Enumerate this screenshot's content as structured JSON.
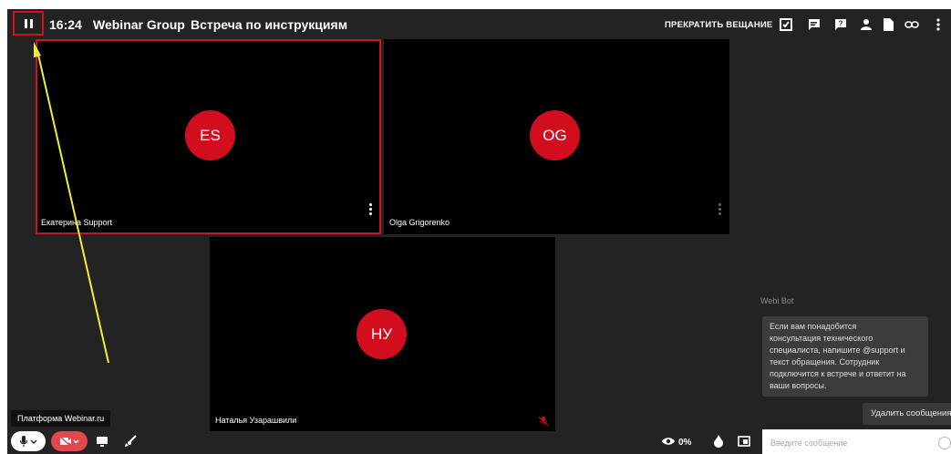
{
  "header": {
    "time": "16:24",
    "group": "Webinar Group",
    "title": "Встреча по инструкциям",
    "stop_broadcast": "ПРЕКРАТИТЬ ВЕЩАНИЕ",
    "icons": [
      "tasks-icon",
      "chat-icon",
      "question-icon",
      "person-icon",
      "document-icon",
      "link-icon",
      "more-icon"
    ]
  },
  "participants": [
    {
      "initials": "ES",
      "name": "Екатерина Support",
      "active": true
    },
    {
      "initials": "OG",
      "name": "Olga Grigorenko",
      "active": false
    },
    {
      "initials": "НУ",
      "name": "Наталья Узарашвили",
      "active": false,
      "muted": true
    }
  ],
  "chat": {
    "sender": "Webi Bot",
    "message": "Если вам понадобится\nконсультация технического\nспециалиста, напишите @support и\nтекст обращения. Сотрудник\nподключится к встрече и ответит на\nваши вопросы.",
    "delete_button": "Удалить сообщения",
    "input_placeholder": "Введите сообщение"
  },
  "tooltip": "Платформа Webinar.ru",
  "bottom": {
    "view_percent": "0%"
  },
  "colors": {
    "accent": "#d10d1e",
    "background": "#232323",
    "annotation_arrow": "#f2ee2e"
  }
}
